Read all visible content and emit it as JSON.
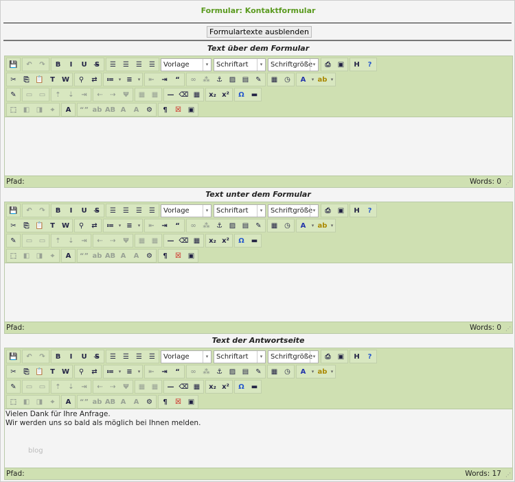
{
  "page_title": "Formular: Kontaktformular",
  "toggle_button": "Formulartexte ausblenden",
  "toolbar": {
    "selects": {
      "format": "Vorlage",
      "font": "Schriftart",
      "size": "Schriftgröße"
    },
    "rows": [
      [
        [
          [
            "save-icon",
            0
          ]
        ],
        [
          [
            "undo-icon",
            1
          ],
          [
            "redo-icon",
            1
          ]
        ],
        [
          [
            "bold-icon",
            0
          ],
          [
            "italic-icon",
            0
          ],
          [
            "underline-icon",
            0
          ],
          [
            "strikethrough-icon",
            0
          ]
        ],
        [
          [
            "align-left-icon",
            0
          ],
          [
            "align-center-icon",
            0
          ],
          [
            "align-right-icon",
            0
          ],
          [
            "align-justify-icon",
            0
          ]
        ],
        "SELECTS",
        [
          [
            "print-icon",
            0
          ],
          [
            "fullscreen-icon",
            0
          ]
        ],
        [
          [
            "html-icon",
            0
          ],
          [
            "help-icon",
            0
          ]
        ]
      ],
      [
        [
          [
            "cut-icon",
            0
          ],
          [
            "copy-icon",
            0
          ],
          [
            "paste-icon",
            0
          ],
          [
            "paste-text-icon",
            0
          ],
          [
            "paste-word-icon",
            0
          ]
        ],
        [
          [
            "find-icon",
            0
          ],
          [
            "replace-icon",
            0
          ]
        ],
        [
          [
            "bullet-list-icon",
            0,
            1
          ],
          [
            "numbered-list-icon",
            0,
            1
          ]
        ],
        [
          [
            "outdent-icon",
            1
          ],
          [
            "indent-icon",
            0
          ],
          [
            "blockquote-icon",
            0
          ]
        ],
        [
          [
            "link-icon",
            1
          ],
          [
            "unlink-icon",
            1
          ],
          [
            "anchor-icon",
            0
          ],
          [
            "image-icon",
            0
          ],
          [
            "media-icon",
            0
          ],
          [
            "cleanup-icon",
            0
          ]
        ],
        [
          [
            "insert-date-icon",
            0
          ],
          [
            "insert-time-icon",
            0
          ]
        ],
        [
          [
            "text-color-icon",
            0,
            1
          ],
          [
            "background-color-icon",
            0,
            1
          ]
        ]
      ],
      [
        [
          [
            "style-props-icon",
            0
          ]
        ],
        [
          [
            "row-props-icon",
            1
          ],
          [
            "cell-props-icon",
            1
          ]
        ],
        [
          [
            "row-before-icon",
            1
          ],
          [
            "row-after-icon",
            1
          ],
          [
            "delete-row-icon",
            1
          ]
        ],
        [
          [
            "col-before-icon",
            1
          ],
          [
            "col-after-icon",
            1
          ],
          [
            "delete-col-icon",
            1
          ]
        ],
        [
          [
            "split-cells-icon",
            1
          ],
          [
            "merge-cells-icon",
            1
          ]
        ],
        [
          [
            "horizontal-rule-icon",
            0
          ],
          [
            "remove-format-icon",
            0
          ],
          [
            "table-icon",
            0
          ]
        ],
        [
          [
            "subscript-icon",
            0
          ],
          [
            "superscript-icon",
            0
          ]
        ],
        [
          [
            "charmap-icon",
            0
          ],
          [
            "nonbreaking-icon",
            0
          ]
        ]
      ],
      [
        [
          [
            "insert-layer-icon",
            0
          ],
          [
            "move-forward-icon",
            1
          ],
          [
            "move-backward-icon",
            1
          ],
          [
            "absolute-icon",
            1
          ]
        ],
        [
          [
            "styles-icon",
            0
          ]
        ],
        [
          [
            "cite-icon",
            1
          ],
          [
            "abbr-icon",
            1
          ],
          [
            "acronym-icon",
            1
          ],
          [
            "del-icon",
            1
          ],
          [
            "ins-icon",
            1
          ],
          [
            "attribs-icon",
            0
          ]
        ],
        [
          [
            "visual-chars-icon",
            0
          ],
          [
            "template-icon",
            0
          ],
          [
            "visual-aid-icon",
            0
          ]
        ]
      ]
    ]
  },
  "editors": [
    {
      "title": "Text über dem Formular",
      "content": [],
      "path_label": "Pfad:",
      "words": "Words: 0"
    },
    {
      "title": "Text unter dem Formular",
      "content": [],
      "path_label": "Pfad:",
      "words": "Words: 0"
    },
    {
      "title": "Text der Antwortseite",
      "content": [
        "Vielen Dank für Ihre Anfrage.",
        "Wir werden uns so bald als möglich bei Ihnen melden."
      ],
      "path_label": "Pfad:",
      "words": "Words: 17",
      "watermark": "blog"
    }
  ]
}
